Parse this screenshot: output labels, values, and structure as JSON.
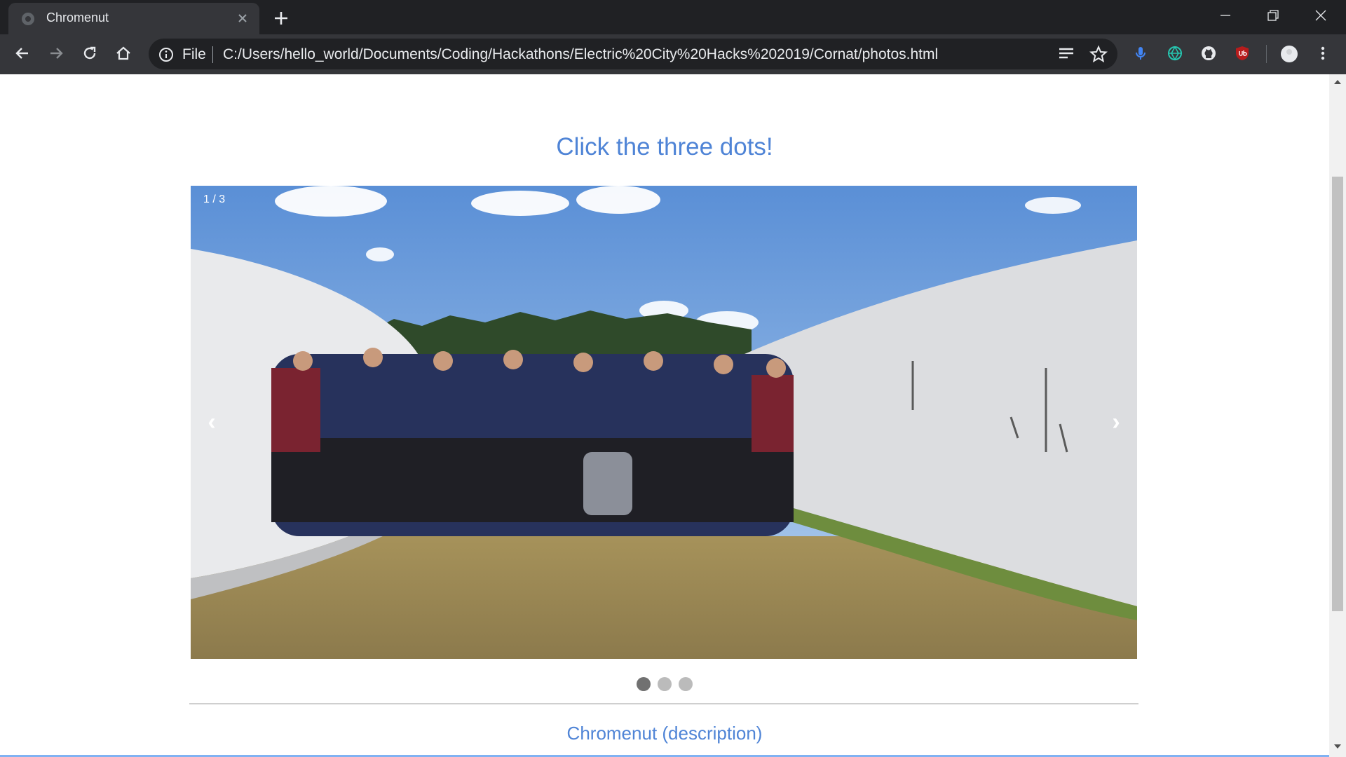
{
  "browser": {
    "tab_title": "Chromenut",
    "address_scheme": "File",
    "url": "C:/Users/hello_world/Documents/Coding/Hackathons/Electric%20City%20Hacks%202019/Cornat/photos.html"
  },
  "page": {
    "heading": "Click the three dots!",
    "slide_counter": "1 / 3",
    "prev_arrow": "‹",
    "next_arrow": "›",
    "dots_total": 3,
    "active_dot": 1,
    "description_link": "Chromenut (description)"
  },
  "colors": {
    "link_blue": "#4f84d6",
    "tab_bg": "#35363a",
    "titlebar_bg": "#202124",
    "dot_active": "#717171",
    "dot_inactive": "#bbbbbb"
  }
}
